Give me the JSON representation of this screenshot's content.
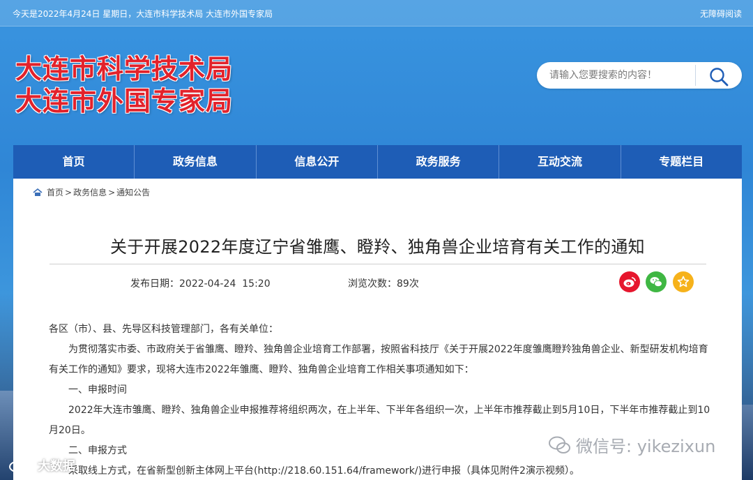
{
  "topbar": {
    "date_text": "今天是2022年4月24日 星期日，大连市科学技术局 大连市外国专家局",
    "accessibility_label": "无障碍阅读"
  },
  "header": {
    "logo_line1": "大连市科学技术局",
    "logo_line2": "大连市外国专家局",
    "search_placeholder": "请输入您要搜索的内容！",
    "search_icon": "search-icon"
  },
  "nav": {
    "items": [
      {
        "label": "首页"
      },
      {
        "label": "政务信息"
      },
      {
        "label": "信息公开"
      },
      {
        "label": "政务服务"
      },
      {
        "label": "互动交流"
      },
      {
        "label": "专题栏目"
      }
    ]
  },
  "breadcrumb": {
    "home": "首页",
    "level1": "政务信息",
    "level2": "通知公告",
    "separator": ">"
  },
  "article": {
    "title": "关于开展2022年度辽宁省雏鹰、瞪羚、独角兽企业培育有关工作的通知",
    "publish_label": "发布日期：",
    "publish_value": "2022-04-24  15:20",
    "views_label": "浏览次数：",
    "views_value": "89次",
    "paragraphs": [
      "各区（市）、县、先导区科技管理部门，各有关单位：",
      "为贯彻落实市委、市政府关于省雏鹰、瞪羚、独角兽企业培育工作部署，按照省科技厅《关于开展2022年度雏鹰瞪羚独角兽企业、新型研发机构培育有关工作的通知》要求，现将大连市2022年雏鹰、瞪羚、独角兽企业培育工作相关事项通知如下：",
      "一、申报时间",
      "2022年大连市雏鹰、瞪羚、独角兽企业申报推荐将组织两次，在上半年、下半年各组织一次，上半年市推荐截止到5月10日，下半年市推荐截止到10月20日。",
      "二、申报方式",
      "采取线上方式，在省新型创新主体网上平台(http://218.60.151.64/framework/)进行申报（具体见附件2演示视频）。"
    ]
  },
  "share": {
    "weibo_icon": "weibo-icon",
    "wechat_icon": "wechat-icon",
    "favorite_icon": "star-icon"
  },
  "watermarks": {
    "right": "微信号: yikezixun",
    "left": "大数据"
  },
  "colors": {
    "nav_bg": "#1e5db6",
    "logo_red": "#e2222b",
    "weibo": "#e6162d",
    "wechat": "#3fb743",
    "favorite": "#f6b21b"
  }
}
